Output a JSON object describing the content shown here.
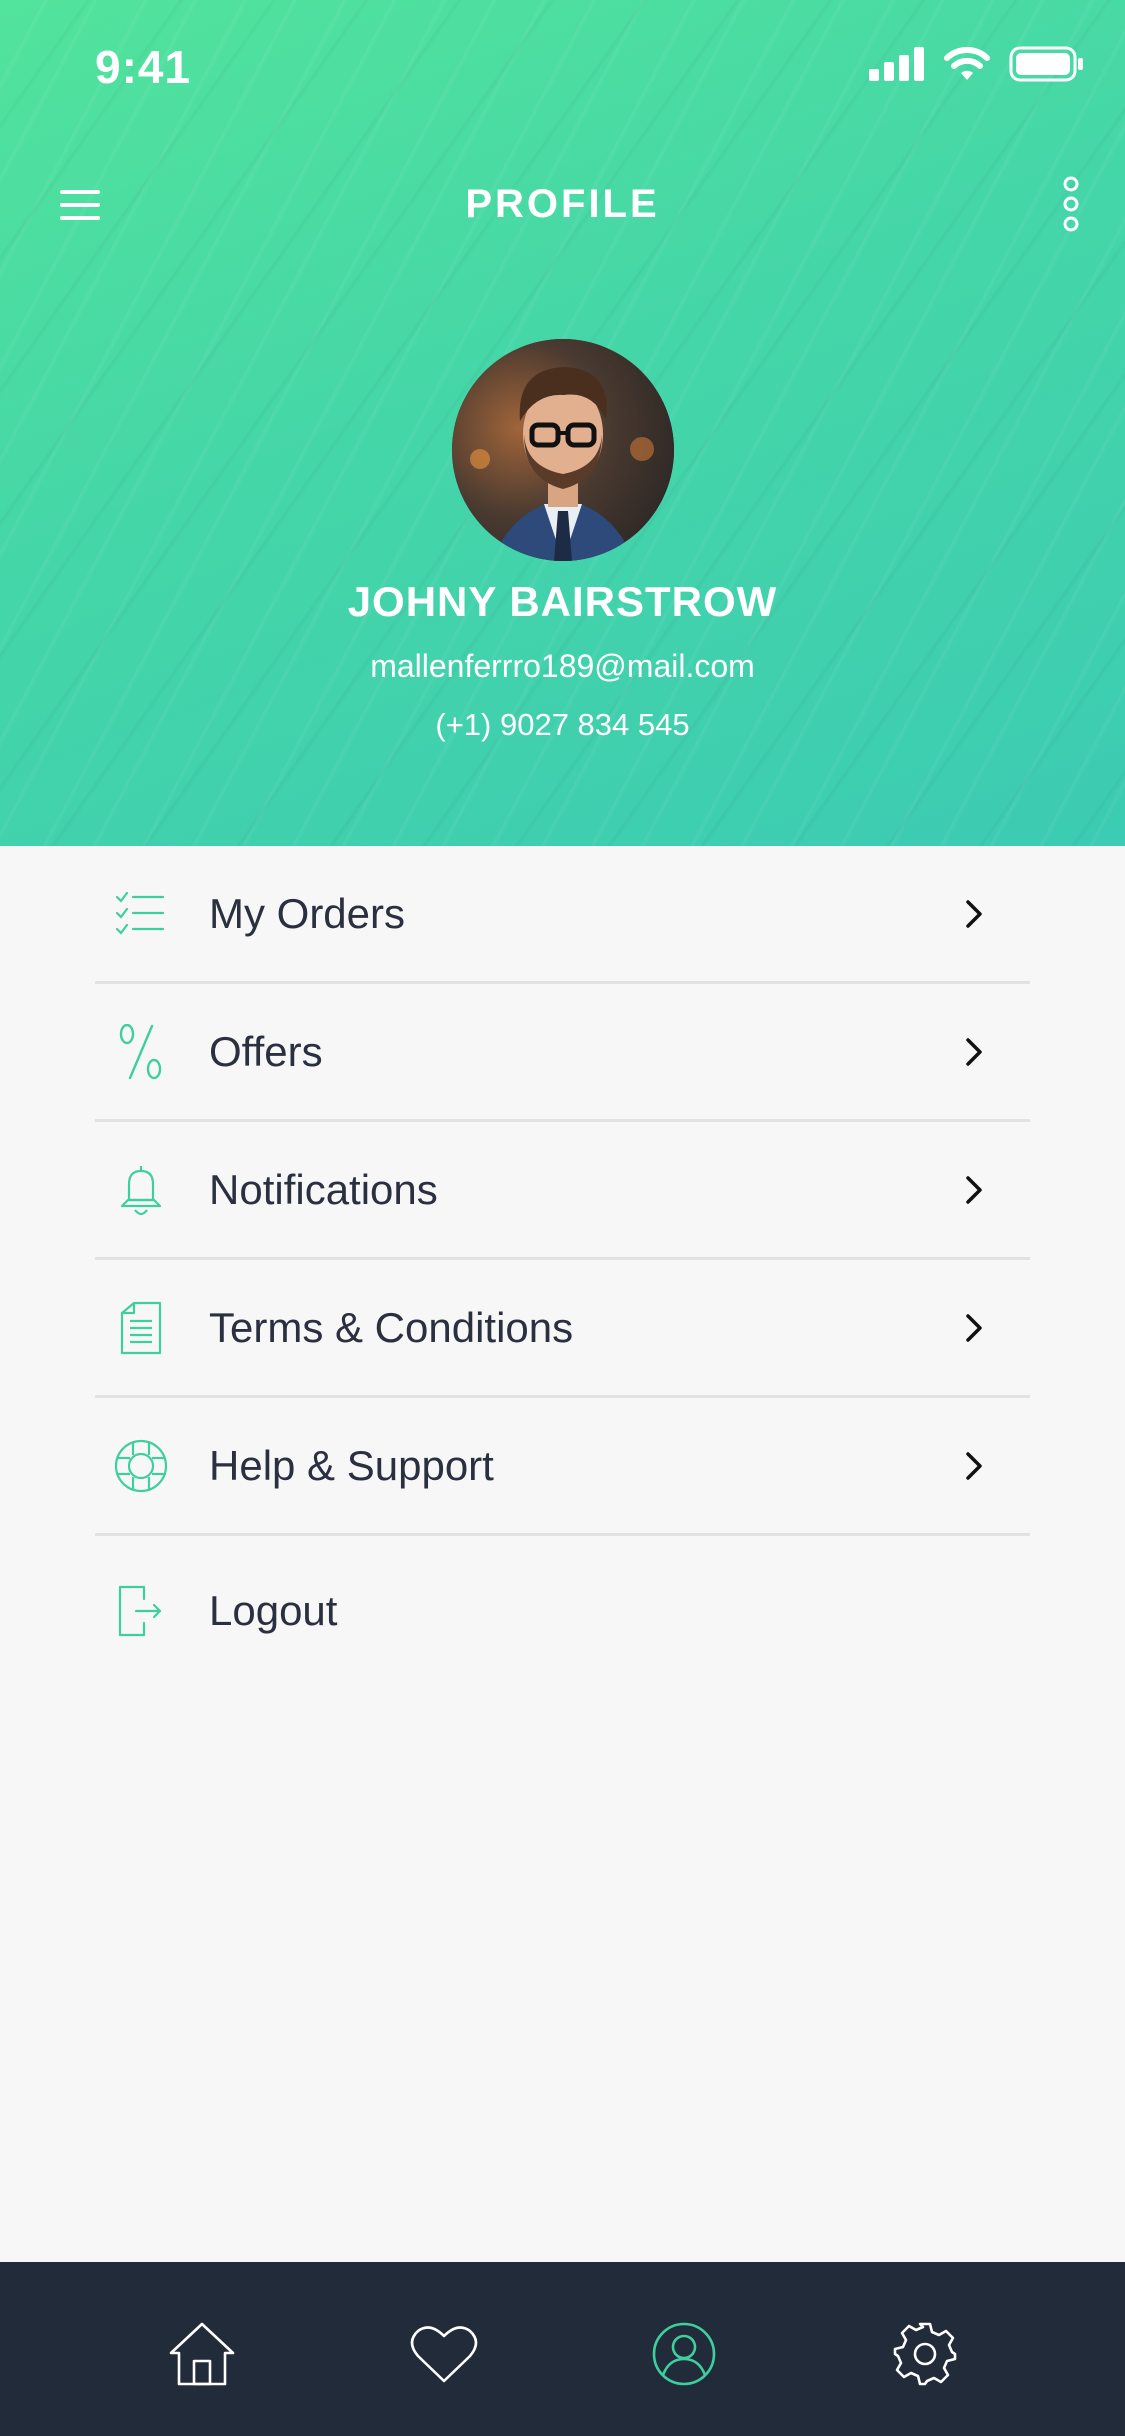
{
  "status_bar": {
    "time": "9:41"
  },
  "header": {
    "title": "PROFILE"
  },
  "profile": {
    "name": "JOHNY BAIRSTROW",
    "email": "mallenferrro189@mail.com",
    "phone": "(+1) 9027 834 545"
  },
  "menu": {
    "items": [
      {
        "label": "My Orders",
        "icon": "checklist-icon"
      },
      {
        "label": "Offers",
        "icon": "percent-icon"
      },
      {
        "label": "Notifications",
        "icon": "bell-icon"
      },
      {
        "label": "Terms & Conditions",
        "icon": "document-icon"
      },
      {
        "label": "Help & Support",
        "icon": "lifebuoy-icon"
      },
      {
        "label": "Logout",
        "icon": "logout-icon"
      }
    ]
  },
  "tabbar": {
    "tabs": [
      {
        "icon": "home-icon",
        "active": false
      },
      {
        "icon": "heart-icon",
        "active": false
      },
      {
        "icon": "profile-icon",
        "active": true
      },
      {
        "icon": "settings-icon",
        "active": false
      }
    ]
  },
  "colors": {
    "accent": "#3ecf9e",
    "header_top": "#52e39c",
    "header_bottom": "#3ccbb3",
    "tabbar_bg": "#222b3a",
    "text_dark": "#2b3040"
  }
}
